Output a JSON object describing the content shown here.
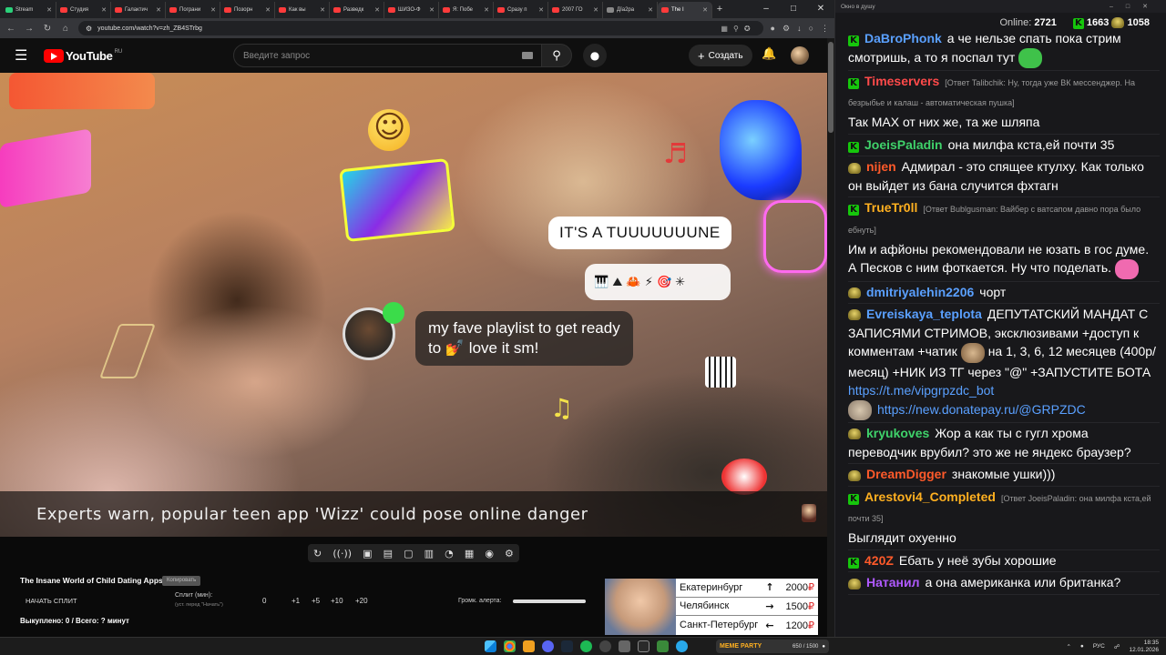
{
  "browser": {
    "tabs": [
      {
        "label": "Stream",
        "color": "#2bd17a",
        "active": false
      },
      {
        "label": "Студия",
        "color": "#ff3b3b",
        "active": false
      },
      {
        "label": "Галактич",
        "color": "#ff3b3b",
        "active": false
      },
      {
        "label": "Пограни",
        "color": "#ff3b3b",
        "active": false
      },
      {
        "label": "Позорн",
        "color": "#ff3b3b",
        "active": false
      },
      {
        "label": "Как вы",
        "color": "#ff3b3b",
        "active": false
      },
      {
        "label": "Разведк",
        "color": "#ff3b3b",
        "active": false
      },
      {
        "label": "ШИЗО-Ф",
        "color": "#ff3b3b",
        "active": false
      },
      {
        "label": "Я: Побе",
        "color": "#ff3b3b",
        "active": false
      },
      {
        "label": "Сразу п",
        "color": "#ff3b3b",
        "active": false
      },
      {
        "label": "2007 ГО",
        "color": "#ff3b3b",
        "active": false
      },
      {
        "label": "Дїа2ра",
        "color": "#888888",
        "active": false
      },
      {
        "label": "The I",
        "color": "#ff3b3b",
        "active": true
      }
    ],
    "url": "youtube.com/watch?v=zh_ZB4STrbg"
  },
  "youtube": {
    "logo_text": "YouTube",
    "region": "RU",
    "search_placeholder": "Введите запрос",
    "create_label": "Создать"
  },
  "video": {
    "bubble_tune": "IT'S A TUUUUUUUNE",
    "bubble_playlist_line1": "my fave playlist to get ready",
    "bubble_playlist_line2": "to 💅 love it sm!",
    "emoji_row": "🎹 ⛰ 🦀 ⚡ 🎯 ✳",
    "lower_third": "Experts warn, popular teen app 'Wizz' could pose online danger"
  },
  "extension": {
    "toolbar_icons": [
      "↻",
      "((·))",
      "▣",
      "▤",
      "▢",
      "▥",
      "◔",
      "▦",
      "◉",
      "⚙"
    ],
    "video_title": "The Insane World of Child Dating Apps",
    "copy_label": "Копировать",
    "start_split": "НАЧАТЬ СПЛИТ",
    "split_label": "Сплит (мин):",
    "split_sub": "(уст. перед \"Начать\")",
    "split_value": "0",
    "split_steps": [
      "+1",
      "+5",
      "+10",
      "+20"
    ],
    "alert_label": "Громк. алерта:",
    "alert_volume": 1.0,
    "bought": "Выкуплено: 0 / Всего: ? минут"
  },
  "news_banner": {
    "rows": [
      {
        "city": "Екатеринбург",
        "arrow": "🡅",
        "arrow_char": "↑",
        "price": "2000",
        "currency": "₽"
      },
      {
        "city": "Челябинск",
        "arrow_char": "→",
        "price": "1500",
        "currency": "₽"
      },
      {
        "city": "Санкт-Петербург",
        "arrow_char": "←",
        "price": "1200",
        "currency": "₽"
      }
    ]
  },
  "chat": {
    "window_title": "Окно в душу",
    "online_label": "Online:",
    "online_count": "2721",
    "kick_count": "1663",
    "twitch_count": "1058",
    "messages": [
      {
        "badge": "kick",
        "nick": "DaBroPhonk",
        "color": "#5aa0ff",
        "reply": "",
        "text": "а че нельзе спать пока стрим смотришь, а то я поспал тут",
        "emote": "#3fc24a"
      },
      {
        "badge": "kick",
        "nick": "Timeservers",
        "color": "#ff4a4a",
        "reply": "[Ответ Talibchik: Ну, тогда уже ВК мессенджер. На безрыбье и калаш - автоматическая пушка]",
        "text": "Так MAX от них же, та же шляпа",
        "emote": ""
      },
      {
        "badge": "kick",
        "nick": "JoeisPaladin",
        "color": "#3fd16a",
        "reply": "",
        "text": "она милфа кста,ей почти 35",
        "emote": ""
      },
      {
        "badge": "twitch",
        "nick": "nijen",
        "color": "#ff5a2a",
        "reply": "",
        "text": "Адмирал - это спящее ктулху. Как только он выйдет из бана случится фхтагн",
        "emote": ""
      },
      {
        "badge": "kick",
        "nick": "TrueTr0ll",
        "color": "#ffb020",
        "reply": "[Ответ Bublgusman: Вайбер с ватсапом давно пора было ебнуть]",
        "text": "Им и афйоны рекомендовали не юзать в гос думе. А Песков с ним фоткается. Ну что поделать.",
        "emote": "#f06ab0"
      },
      {
        "badge": "twitch",
        "nick": "dmitriyalehin2206",
        "color": "#5aa0ff",
        "reply": "",
        "text": "чорт",
        "emote": ""
      },
      {
        "badge": "twitch",
        "nick": "Evreiskaya_teplota",
        "color": "#5aa0ff",
        "reply": "",
        "text": "ДЕПУТАТСКИЙ МАНДАТ С ЗАПИСЯМИ СТРИМОВ, эксклюзивами +доступ к комментам +чатик",
        "text2": "на 1, 3, 6, 12 месяцев (400р/месяц) +НИК ИЗ ТГ через \"@\" +ЗАПУСТИТЕ БОТА",
        "link1": "https://t.me/vipgrpzdc_bot",
        "link2": "https://new.donatepay.ru/@GRPZDC",
        "emote": ""
      },
      {
        "badge": "twitch",
        "nick": "kryukoves",
        "color": "#3fd16a",
        "reply": "",
        "text": "Жор а как ты с гугл хрома переводчик врубил? это же не яндекс браузер?",
        "emote": ""
      },
      {
        "badge": "twitch",
        "nick": "DreamDigger",
        "color": "#ff5a2a",
        "reply": "",
        "text": "знакомые ушки)))",
        "emote": ""
      },
      {
        "badge": "kick",
        "nick": "Arestovi4_Completed",
        "color": "#ffb020",
        "reply": "[Ответ JoeisPaladin: она милфа кста,ей почти 35]",
        "text": "Выглядит охуенно",
        "emote": ""
      },
      {
        "badge": "kick",
        "nick": "420Z",
        "color": "#ff5a2a",
        "reply": "",
        "text": "Ебать у неё зубы хорошие",
        "emote": ""
      },
      {
        "badge": "twitch",
        "nick": "Натанил",
        "color": "#b05aff",
        "reply": "",
        "text": "а она американка или британка?",
        "emote": ""
      }
    ]
  },
  "taskbar": {
    "meme_label": "MEME PARTY",
    "meme_count": "650 / 1500",
    "lang": "РУС",
    "time": "18:35",
    "date": "12.01.2026"
  }
}
